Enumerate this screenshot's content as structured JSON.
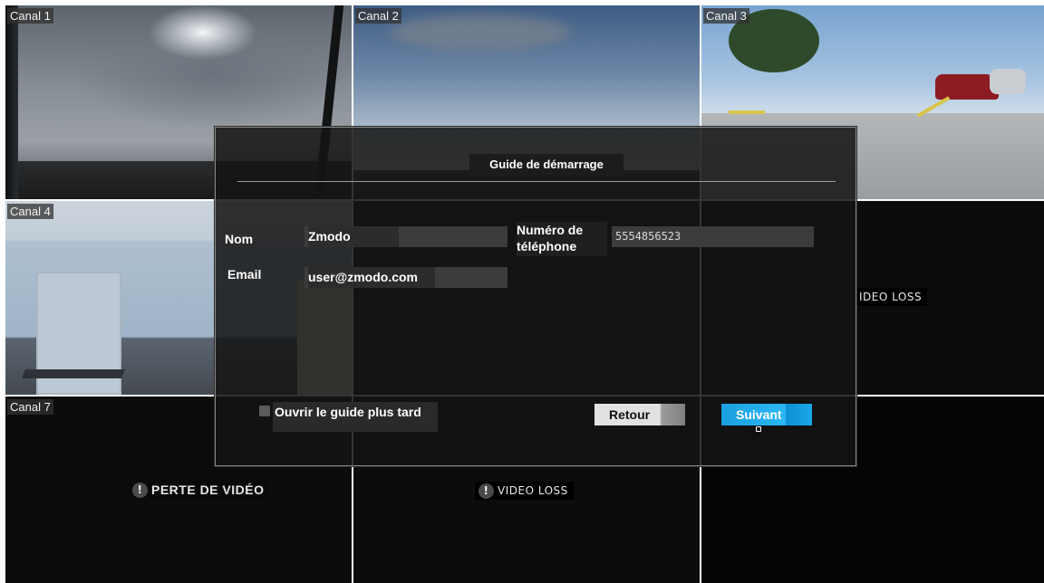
{
  "channels": [
    {
      "label": "Canal 1"
    },
    {
      "label": "Canal 2"
    },
    {
      "label": "Canal 3"
    },
    {
      "label": "Canal 4"
    },
    {
      "label": "Canal 7"
    }
  ],
  "video_loss": {
    "ch6_text": "IDEO LOSS",
    "ch7_text": "PERTE DE VIDÉO",
    "ch8_text": "VIDEO LOSS",
    "icon_glyph": "!"
  },
  "dialog": {
    "title": "Guide de démarrage",
    "name_label": "Nom",
    "name_value": "Zmodo",
    "phone_label": "Numéro de téléphone",
    "phone_value": "5554856523",
    "email_label": "Email",
    "email_value": "user@zmodo.com",
    "later_label": "Ouvrir le guide plus tard",
    "later_checked": false,
    "back_label": "Retour",
    "next_label": "Suivant"
  },
  "colors": {
    "next_button": "#1aa7ea",
    "back_button": "#e2e2e2",
    "dialog_bg": "#141414"
  }
}
